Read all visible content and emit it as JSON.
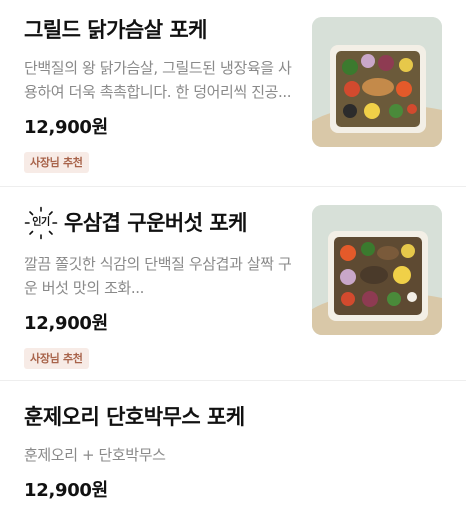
{
  "menu_items": [
    {
      "title": "그릴드 닭가슴살 포케",
      "description": "단백질의 왕 닭가슴살, 그릴드된 냉장육을 사용하여 더욱 촉촉합니다. 한 덩어리씩 진공...",
      "price": "12,900원",
      "badge": "사장님 추천",
      "image": "poke-bowl-photo"
    },
    {
      "popular_label": "인기",
      "title": "우삼겹 구운버섯 포케",
      "description": "깔끔 쫄깃한 식감의 단백질 우삼겹과 살짝 구운 버섯 맛의 조화...",
      "price": "12,900원",
      "badge": "사장님 추천",
      "image": "poke-bowl-photo"
    },
    {
      "title": "훈제오리 단호박무스 포케",
      "description": "훈제오리 + 단호박무스",
      "price": "12,900원"
    }
  ],
  "colors": {
    "badge_bg": "#f7ebe6",
    "badge_text": "#a8634a",
    "description": "#8a8a8a",
    "divider": "#eeeeee"
  }
}
